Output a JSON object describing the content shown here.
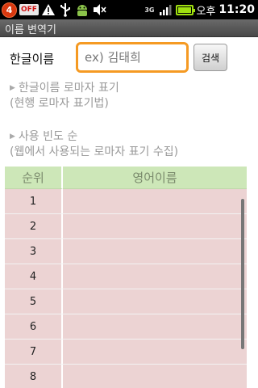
{
  "status_bar": {
    "notification_count": "4",
    "off_label": "OFF",
    "network_label": "3G",
    "battery_level": 1.0,
    "clock_ampm": "오후",
    "clock_time": "11:20"
  },
  "app": {
    "title": "이름 변역기"
  },
  "search": {
    "label": "한글이름",
    "placeholder": "ex) 김태희",
    "value": "",
    "button_label": "검색"
  },
  "options": [
    {
      "line1": "한글이름 로마자 표기",
      "line2": "(현행 로마자 표기법)"
    },
    {
      "line1": "사용 빈도 순",
      "line2": "(웹에서 사용되는 로마자 표기 수집)"
    }
  ],
  "table": {
    "headers": {
      "rank": "순위",
      "name": "영어이름"
    },
    "rows": [
      {
        "rank": "1",
        "name": ""
      },
      {
        "rank": "2",
        "name": ""
      },
      {
        "rank": "3",
        "name": ""
      },
      {
        "rank": "4",
        "name": ""
      },
      {
        "rank": "5",
        "name": ""
      },
      {
        "rank": "6",
        "name": ""
      },
      {
        "rank": "7",
        "name": ""
      },
      {
        "rank": "8",
        "name": ""
      }
    ]
  },
  "colors": {
    "accent_focus": "#f59a23",
    "header_bg": "#cde7b8",
    "row_bg": "#ecd3d3",
    "notification": "#d9380f",
    "battery": "#9fe010"
  },
  "icons": [
    "notification-badge",
    "warning-icon",
    "usb-icon",
    "android-debug-icon",
    "mute-icon",
    "signal-icon",
    "battery-icon"
  ]
}
